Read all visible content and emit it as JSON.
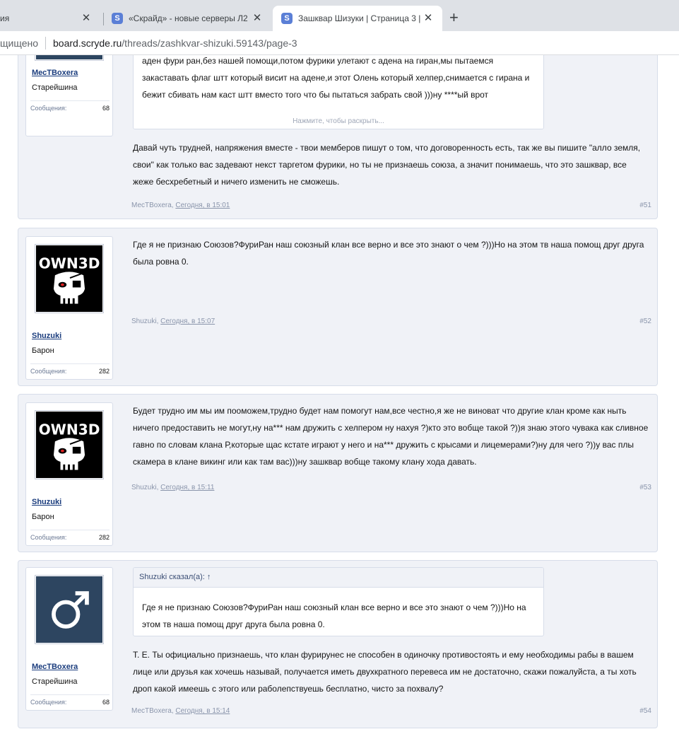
{
  "browser": {
    "tabs": [
      {
        "title": "ия",
        "favicon": "",
        "active": false
      },
      {
        "title": "«Скрайд» - новые серверы Л2",
        "favicon": "S",
        "active": false
      },
      {
        "title": "Зашквар Шизуки | Страница 3 |",
        "favicon": "S",
        "active": true
      }
    ],
    "close_glyph": "✕",
    "new_tab_glyph": "+",
    "address": {
      "security": "щищено",
      "host": "board.scryde.ru",
      "path": "/threads/zashkvar-shizuki.59143/page-3"
    }
  },
  "posts": [
    {
      "author": "МесТBoxera",
      "title": "Старейшина",
      "messages_label": "Сообщения:",
      "messages_count": "68",
      "quote_body": "))пацаны сыграли как выгодно им,мы играем как выгодно нам,на этом просто у викенгов кастуют аден фури ран,без нашей помощи,потом фурики улетают с адена на гиран,мы пытаемся закаставать флаг штт который висит на адене,и этот Олень который хелпер,снимается с гирана и бежит сбивать нам каст штт вместо того что бы пытаться забрать свой )))ну ****ый врот",
      "expand_label": "Нажмите, чтобы раскрыть...",
      "text": "Давай чуть трудней, напряжения вместе - твои мемберов пишут о том, что договоренность есть, так же вы пишите \"алло земля, свои\" как только вас задевают некст таргетом фурики, но ты не признаешь союза, а значит понимаешь, что это зашквар, все жеже бесхребетный и ничего изменить не сможешь.",
      "meta_author": "МесТBoxera",
      "meta_date": "Сегодня, в 15:01",
      "number": "#51"
    },
    {
      "author": "Shuzuki",
      "title": "Барон",
      "messages_label": "Сообщения:",
      "messages_count": "282",
      "avatar_text": "OWN3D",
      "text": "Где я не признаю Союзов?ФуриРан наш союзный клан все верно и все это знают о чем ?)))Но на этом тв наша помощ друг друга была ровна 0.",
      "meta_author": "Shuzuki",
      "meta_date": "Сегодня, в 15:07",
      "number": "#52"
    },
    {
      "author": "Shuzuki",
      "title": "Барон",
      "messages_label": "Сообщения:",
      "messages_count": "282",
      "avatar_text": "OWN3D",
      "text": "Будет трудно им мы им пооможем,трудно будет нам помогут нам,все честно,я же не виноват что другие клан кроме как ныть ничего предоставить не могут,ну на*** нам дружить с хелпером ну нахуя ?)кто это вобще такой ?))я знаю этого чувака как сливное гавно по словам клана Р,которые щас кстате играют у него и на*** дружить с крысами и лицемерами?)ну для чего ?))у вас плы скамера в клане викинг или как там вас)))ну зашквар вобще такому клану хода давать.",
      "meta_author": "Shuzuki",
      "meta_date": "Сегодня, в 15:11",
      "number": "#53"
    },
    {
      "author": "МесТBoxera",
      "title": "Старейшина",
      "messages_label": "Сообщения:",
      "messages_count": "68",
      "quote_head": "Shuzuki сказал(а): ↑",
      "quote_body": "Где я не признаю Союзов?ФуриРан наш союзный клан все верно и все это знают о чем ?)))Но на этом тв наша помощ друг друга была ровна 0.",
      "text": "Т. Е. Ты официально признаешь, что клан фурирунес не способен в одиночку противостоять и ему необходимы рабы в вашем лице или друзья как хочешь называй, получается иметь двухкратного перевеса им не достаточно, скажи пожалуйста, а ты хоть дроп какой имеешь с этого или раболепствуешь бесплатно, чисто за похвалу?",
      "meta_author": "МесТBoxera",
      "meta_date": "Сегодня, в 15:14",
      "number": "#54"
    }
  ],
  "colors": {
    "post_bg": "#f0f2f7",
    "username": "#1a3c7d",
    "male_avatar_bg": "#2d4560",
    "tab_favicon": "#5b7fd6"
  }
}
